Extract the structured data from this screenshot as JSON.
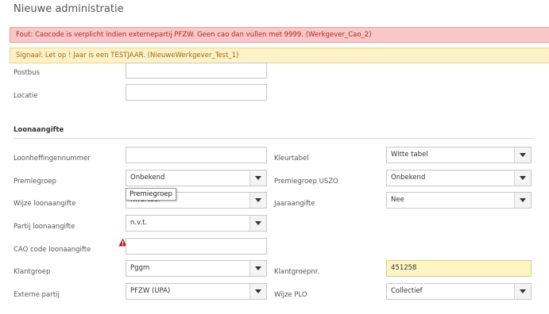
{
  "page": {
    "title": "Nieuwe administratie"
  },
  "alerts": {
    "error": "Fout: Caocode is verplicht indien externepartij PFZW. Geen cao dan vullen met 9999. (Werkgever_Cao_2)",
    "warning": "Signaal: Let op ! Jaar is een TESTJAAR. (NieuweWerkgever_Test_1)"
  },
  "fields": {
    "postbus": {
      "label": "Postbus",
      "value": ""
    },
    "locatie": {
      "label": "Locatie",
      "value": ""
    }
  },
  "loonaangifte": {
    "title": "Loonaangifte",
    "loonheffingennummer": {
      "label": "Loonheffingennummer",
      "value": ""
    },
    "kleurtabel": {
      "label": "Kleurtabel",
      "value": "Witte tabel"
    },
    "premiegroep": {
      "label": "Premiegroep",
      "value": "Onbekend"
    },
    "premiegroep_uszo": {
      "label": "Premiegroep USZO",
      "value": "Onbekend"
    },
    "wijze_loonaangifte": {
      "label": "Wijze loonaangifte",
      "value": "Kwartaal"
    },
    "jaaraangifte": {
      "label": "Jaaraangifte",
      "value": "Nee"
    },
    "partij_loonaangifte": {
      "label": "Partij loonaangifte",
      "value": "n.v.t."
    },
    "cao_code": {
      "label": "CAO code loonaangifte",
      "value": ""
    },
    "klantgroep": {
      "label": "Klantgroep",
      "value": "Pggm"
    },
    "klantgroepnr": {
      "label": "Klantgroepnr.",
      "value": "451258"
    },
    "externe_partij": {
      "label": "Externe partij",
      "value": "PFZW (UPA)"
    },
    "wijze_plo": {
      "label": "Wijze PLO",
      "value": "Collectief"
    }
  },
  "tooltip": {
    "text": "Premiegroep"
  },
  "icons": {
    "warning": "warning-triangle-icon",
    "dropdown": "chevron-down-icon"
  },
  "colors": {
    "error_bg": "#f8c8c8",
    "warning_bg": "#fdf1c8",
    "highlight_bg": "#fdf6c3"
  }
}
